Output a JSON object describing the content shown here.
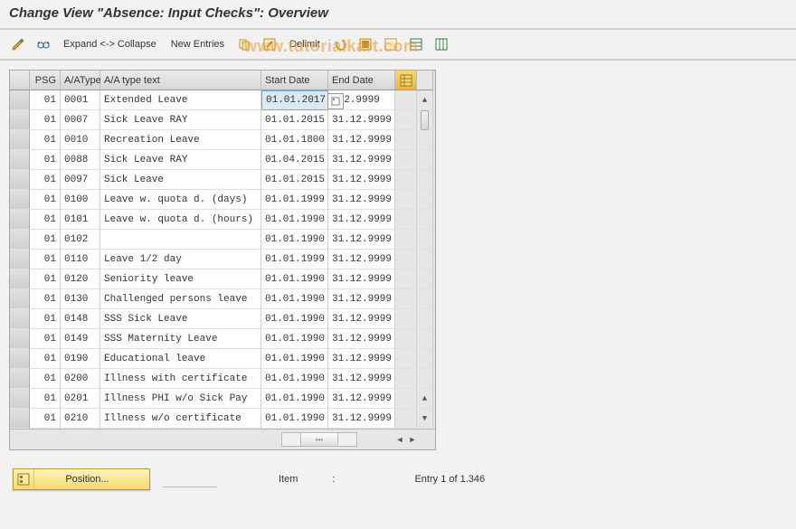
{
  "title": "Change View \"Absence: Input Checks\": Overview",
  "watermark": "www.tutorialkart.com",
  "toolbar": {
    "expand_label": "Expand <-> Collapse",
    "new_entries_label": "New Entries",
    "delimit_label": "Delimit"
  },
  "grid": {
    "headers": {
      "psg": "PSG",
      "aatype": "A/AType",
      "aatext": "A/A type text",
      "start": "Start Date",
      "end": "End Date"
    },
    "rows": [
      {
        "psg": "01",
        "type": "0001",
        "text": "Extended Leave",
        "start": "01.01.2017",
        "end": ".12.9999",
        "selected": true
      },
      {
        "psg": "01",
        "type": "0007",
        "text": "Sick Leave RAY",
        "start": "01.01.2015",
        "end": "31.12.9999"
      },
      {
        "psg": "01",
        "type": "0010",
        "text": "Recreation Leave",
        "start": "01.01.1800",
        "end": "31.12.9999"
      },
      {
        "psg": "01",
        "type": "0088",
        "text": "Sick Leave RAY",
        "start": "01.04.2015",
        "end": "31.12.9999"
      },
      {
        "psg": "01",
        "type": "0097",
        "text": "Sick Leave",
        "start": "01.01.2015",
        "end": "31.12.9999"
      },
      {
        "psg": "01",
        "type": "0100",
        "text": "Leave w. quota d. (days)",
        "start": "01.01.1999",
        "end": "31.12.9999"
      },
      {
        "psg": "01",
        "type": "0101",
        "text": "Leave w. quota d. (hours)",
        "start": "01.01.1990",
        "end": "31.12.9999"
      },
      {
        "psg": "01",
        "type": "0102",
        "text": "",
        "start": "01.01.1990",
        "end": "31.12.9999"
      },
      {
        "psg": "01",
        "type": "0110",
        "text": "Leave 1/2 day",
        "start": "01.01.1999",
        "end": "31.12.9999"
      },
      {
        "psg": "01",
        "type": "0120",
        "text": "Seniority leave",
        "start": "01.01.1990",
        "end": "31.12.9999"
      },
      {
        "psg": "01",
        "type": "0130",
        "text": "Challenged persons leave",
        "start": "01.01.1990",
        "end": "31.12.9999"
      },
      {
        "psg": "01",
        "type": "0148",
        "text": "SSS Sick Leave",
        "start": "01.01.1990",
        "end": "31.12.9999"
      },
      {
        "psg": "01",
        "type": "0149",
        "text": "SSS Maternity Leave",
        "start": "01.01.1990",
        "end": "31.12.9999"
      },
      {
        "psg": "01",
        "type": "0190",
        "text": "Educational leave",
        "start": "01.01.1990",
        "end": "31.12.9999"
      },
      {
        "psg": "01",
        "type": "0200",
        "text": "Illness with certificate",
        "start": "01.01.1990",
        "end": "31.12.9999"
      },
      {
        "psg": "01",
        "type": "0201",
        "text": "Illness PHI w/o Sick Pay",
        "start": "01.01.1990",
        "end": "31.12.9999"
      },
      {
        "psg": "01",
        "type": "0210",
        "text": "Illness w/o certificate",
        "start": "01.01.1990",
        "end": "31.12.9999"
      }
    ]
  },
  "statusbar": {
    "position_label": "Position...",
    "item_label": "Item",
    "item_colon": ":",
    "entry_label": "Entry 1 of 1.346"
  },
  "colors": {
    "highlight_bg": "#dbe7f2",
    "highlight_border": "#7da7d9",
    "button_yellow_top": "#fdf3bf",
    "button_yellow_bottom": "#f4da6c"
  }
}
